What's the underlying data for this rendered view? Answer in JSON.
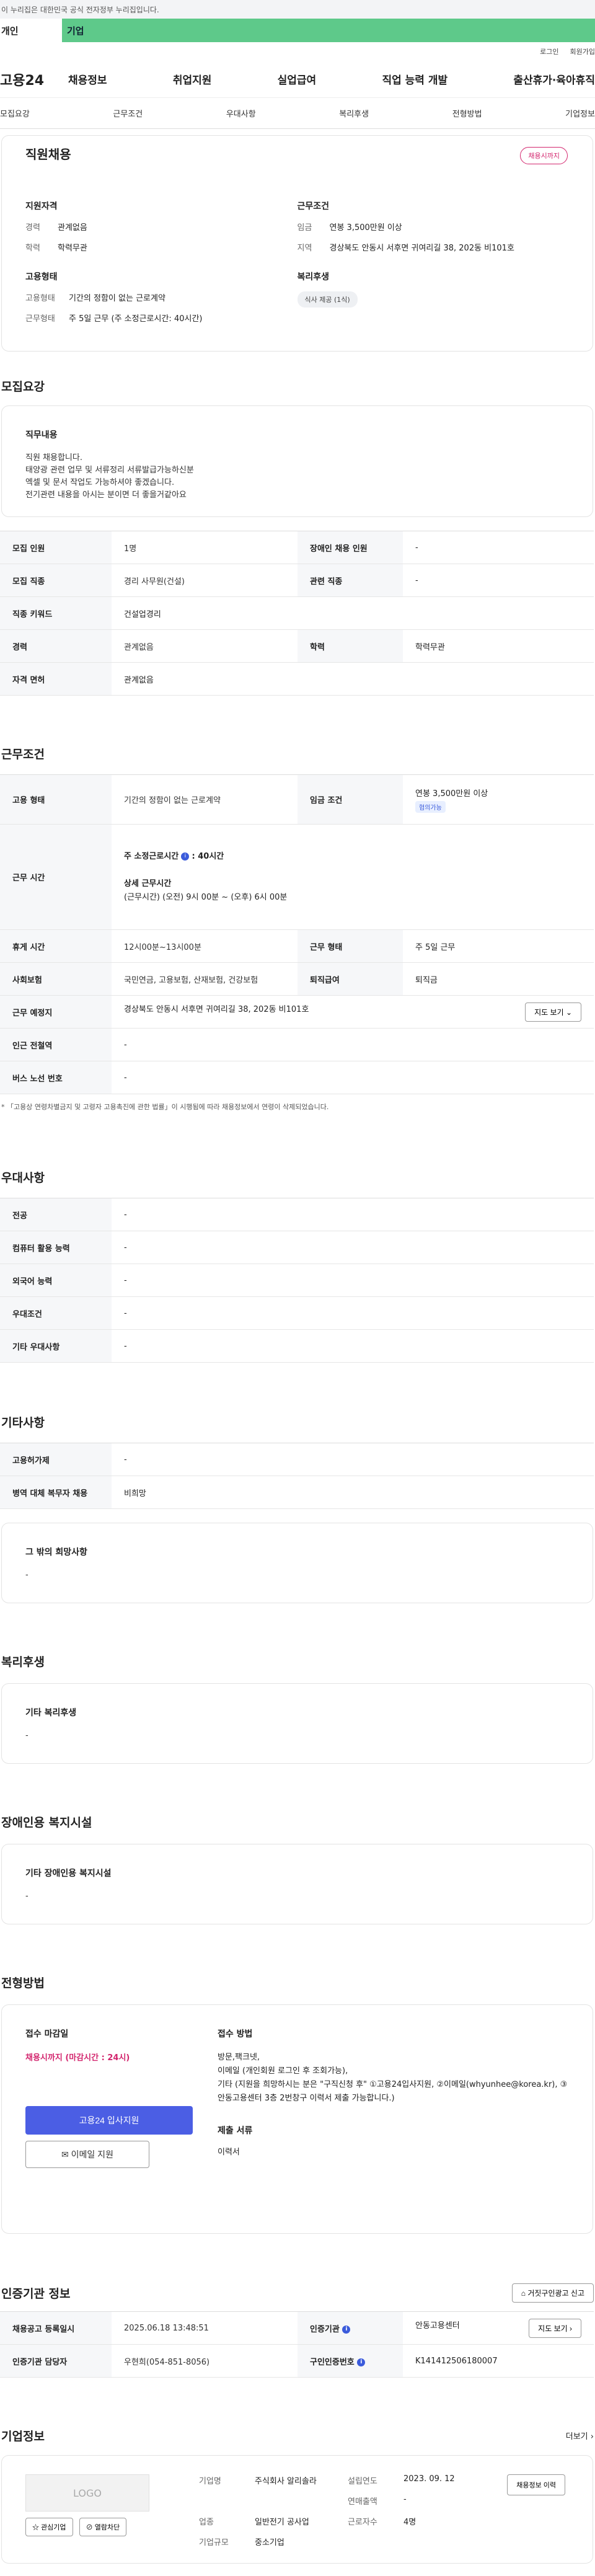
{
  "gov_notice": "이 누리집은 대한민국 공식 전자정부 누리집입니다.",
  "member_tabs": {
    "individual": "개인",
    "corporate": "기업"
  },
  "util": {
    "login": "로그인",
    "join": "회원가입"
  },
  "logo": "고용24",
  "gnb": [
    "채용정보",
    "취업지원",
    "실업급여",
    "직업 능력 개발",
    "출산휴가·육아휴직"
  ],
  "tabs": [
    "모집요강",
    "근무조건",
    "우대사항",
    "복리후생",
    "전형방법",
    "기업정보"
  ],
  "summary": {
    "title": "직원채용",
    "badge": "채용시까지",
    "qual_h": "지원자격",
    "qual": [
      {
        "k": "경력",
        "v": "관계없음"
      },
      {
        "k": "학력",
        "v": "학력무관"
      }
    ],
    "cond_h": "근무조건",
    "cond": [
      {
        "k": "임금",
        "v": "연봉 3,500만원 이상"
      },
      {
        "k": "지역",
        "v": "경상북도 안동시 서후면 귀여리길 38, 202동 비101호"
      }
    ],
    "emp_h": "고용형태",
    "emp": [
      {
        "k": "고용형태",
        "v": "기간의 정함이 없는 근로계약"
      },
      {
        "k": "근무형태",
        "v": "주 5일 근무 (주 소정근로시간: 40시간)"
      }
    ],
    "welfare_h": "복리후생",
    "welfare_pill": "식사 제공 (1식)"
  },
  "recruit": {
    "title": "모집요강",
    "duty_h": "직무내용",
    "duty": "직원 채용합니다.\n태양광 관련 업무 및 서류정리 서류발급가능하신분\n엑셀 및 문서 작업도 가능하셔야 좋겠습니다.\n전기관련 내용을 아시는 분이면 더 좋을거같아요",
    "rows": [
      {
        "k": "모집 인원",
        "v": "1명",
        "k2": "장애인 채용 인원",
        "v2": "-"
      },
      {
        "k": "모집 직종",
        "v": "경리 사무원(건설)",
        "k2": "관련 직종",
        "v2": "-"
      },
      {
        "k": "직종 키워드",
        "v": "건설업경리"
      },
      {
        "k": "경력",
        "v": "관계없음",
        "k2": "학력",
        "v2": "학력무관"
      },
      {
        "k": "자격 면허",
        "v": "관계없음"
      }
    ]
  },
  "work": {
    "title": "근무조건",
    "emp_k": "고용 형태",
    "emp_v": "기간의 정함이 없는 근로계약",
    "wage_k": "임금 조건",
    "wage_v": "연봉 3,500만원 이상",
    "wage_pill": "협의가능",
    "time_k": "근무 시간",
    "time_weekly": "주 소정근로시간",
    "time_weekly_v": ": 40시간",
    "time_detail_h": "상세 근무시간",
    "time_detail": "(근무시간) (오전) 9시 00분 ~ (오후) 6시 00분",
    "rest_k": "휴게 시간",
    "rest_v": "12시00분~13시00분",
    "form_k": "근무 형태",
    "form_v": "주 5일 근무",
    "ins_k": "사회보험",
    "ins_v": "국민연금, 고용보험, 산재보험, 건강보험",
    "sev_k": "퇴직급여",
    "sev_v": "퇴직금",
    "place_k": "근무 예정지",
    "place_v": "경상북도 안동시 서후면 귀여리길 38, 202동 비101호",
    "map_btn": "지도 보기",
    "subway_k": "인근 전철역",
    "subway_v": "-",
    "bus_k": "버스 노선 번호",
    "bus_v": "-",
    "note": "* 「고용상 연령차별금지 및 고령자 고용촉진에 관한 법률」이 시행됨에 따라 채용정보에서 연령이 삭제되었습니다."
  },
  "pref": {
    "title": "우대사항",
    "rows": [
      {
        "k": "전공",
        "v": "-"
      },
      {
        "k": "컴퓨터 활용 능력",
        "v": "-"
      },
      {
        "k": "외국어 능력",
        "v": "-"
      },
      {
        "k": "우대조건",
        "v": "-"
      },
      {
        "k": "기타 우대사항",
        "v": "-"
      }
    ]
  },
  "etc": {
    "title": "기타사항",
    "rows": [
      {
        "k": "고용허가제",
        "v": "-"
      },
      {
        "k": "병역 대체 복무자 채용",
        "v": "비희망"
      }
    ],
    "wish_h": "그 밖의 희망사항",
    "wish_v": "-"
  },
  "welfare": {
    "title": "복리후생",
    "h": "기타 복리후생",
    "v": "-"
  },
  "disabled": {
    "title": "장애인용 복지시설",
    "h": "기타 장애인용 복지시설",
    "v": "-"
  },
  "method": {
    "title": "전형방법",
    "deadline_h": "접수 마감일",
    "deadline_v": "채용시까지 (마감시간 : 24시)",
    "apply_btn": "고용24 입사지원",
    "email_btn": "이메일 지원",
    "way_h": "접수 방법",
    "way_v": "방문,팩크넷,\n이메일 (개인회원 로그인 후 조회가능),\n기타 (지원을 희망하시는 분은 \"구직신청 후\" ①고용24입사지원, ②이메일(whyunhee@korea.kr), ③ 안동고용센터 3층 2번창구 이력서 제출 가능합니다.)",
    "docs_h": "제출 서류",
    "docs_v": "이력서"
  },
  "agency": {
    "title": "인증기관 정보",
    "report_btn": "거짓구인광고 신고",
    "reg_k": "채용공고 등록일시",
    "reg_v": "2025.06.18 13:48:51",
    "org_k": "인증기관",
    "org_v": "안동고용센터",
    "map_btn": "지도 보기",
    "mgr_k": "인증기관 담당자",
    "mgr_v": "우현희(054-851-8056)",
    "no_k": "구인인증번호",
    "no_v": "K141412506180007"
  },
  "company": {
    "title": "기업정보",
    "more": "더보기",
    "logo": "LOGO",
    "fav_btn": "관심기업",
    "block_btn": "열람차단",
    "name_k": "기업명",
    "name_v": "주식회사 알리솔라",
    "year_k": "설립연도",
    "year_v": "2023. 09. 12",
    "sales_k": "연매출액",
    "sales_v": "-",
    "ind_k": "업종",
    "ind_v": "일반전기 공사업",
    "emp_k": "근로자수",
    "emp_v": "4명",
    "size_k": "기업규모",
    "size_v": "중소기업",
    "history_btn": "채용정보 이력"
  }
}
